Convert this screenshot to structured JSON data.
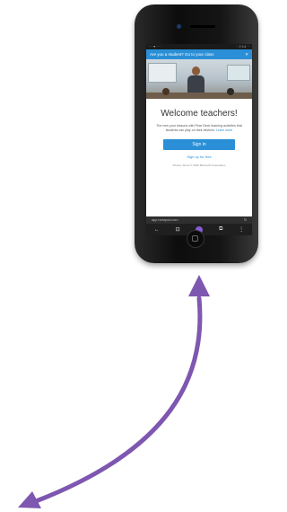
{
  "screen": {
    "status_left": "··· ▾ ·· ·",
    "status_right": "·· 2:14 ··",
    "prompt_text": "Are you a student? Go to your class",
    "prompt_close": "✕",
    "welcome_title": "Welcome teachers!",
    "body_text": "The new your lessons with Pear Deck learning activities that students can play on their devices.",
    "body_link": "Learn more",
    "signin_label": "Sign in",
    "signup_label": "Sign up for free",
    "footer_text": "Privacy Terms © 2020 Microsoft Corporation",
    "url_text": "app.nearpod.com",
    "url_icon": "↻",
    "nav_icons": [
      "←",
      "⊡",
      "●",
      "⧉",
      "⋮"
    ]
  },
  "colors": {
    "accent": "#2a8fd6",
    "arrow": "#7e57b0",
    "nav_active": "#8a5bd6"
  },
  "icons": {
    "arrow": "curved-double-arrow-icon"
  }
}
